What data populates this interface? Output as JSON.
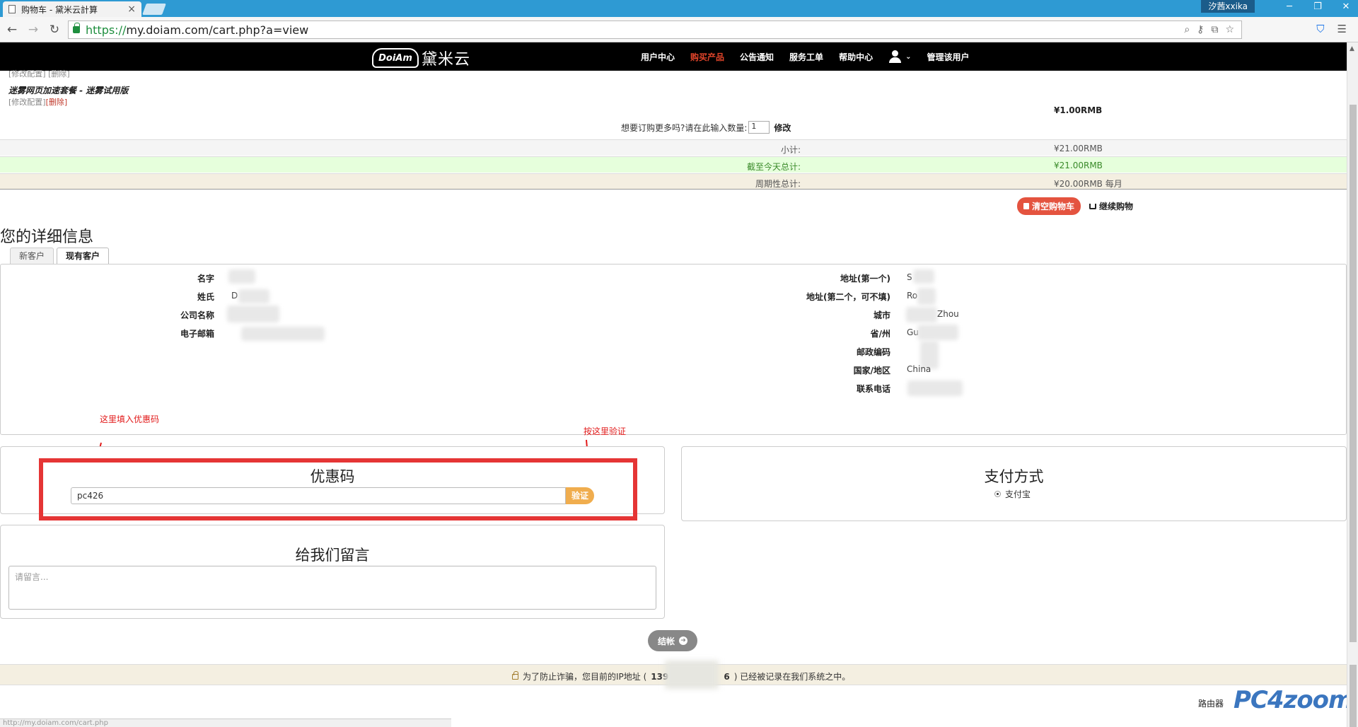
{
  "browser": {
    "tab_title": "购物车 - 黛米云計算",
    "tab_close": "×",
    "profile": "汐茜xxika",
    "url_scheme": "https://",
    "url_rest": "my.doiam.com/cart.php?a=view",
    "status_text": "http://my.doiam.com/cart.php",
    "window_min": "─",
    "window_max": "❐",
    "window_close": "✕"
  },
  "navbar": {
    "logo_mark": "DoiAm",
    "logo_text": "黛米云",
    "items": [
      "用户中心",
      "购买产品",
      "公告通知",
      "服务工单",
      "帮助中心",
      "管理该用户"
    ],
    "active_item": "购买产品"
  },
  "cart": {
    "clipped_links": "[修改配置] [删除]",
    "product_name": "迷雾网页加速套餐 - 迷雾试用版",
    "edit_link": "[修改配置]",
    "delete_link": "[删除]",
    "product_price": "¥1.00RMB",
    "qty_prompt": "想要订购更多吗?请在此输入数量:",
    "qty_value": "1",
    "qty_button": "修改",
    "subtotal_label": "小计:",
    "subtotal_value": "¥21.00RMB",
    "today_label": "截至今天总计:",
    "today_value": "¥21.00RMB",
    "recurring_label": "周期性总计:",
    "recurring_value": "¥20.00RMB 每月",
    "empty_cart": "清空购物车",
    "continue_shopping": "继续购物"
  },
  "details": {
    "title": "您的详细信息",
    "tabs": [
      "新客户",
      "现有客户"
    ],
    "active_tab": "现有客户",
    "left_fields": [
      {
        "label": "名字",
        "value": ""
      },
      {
        "label": "姓氏",
        "value": "D"
      },
      {
        "label": "公司名称",
        "value": ""
      },
      {
        "label": "电子邮箱",
        "value": ""
      }
    ],
    "right_fields": [
      {
        "label": "地址(第一个)",
        "value": "S"
      },
      {
        "label": "地址(第二个，可不填)",
        "value": "Ro"
      },
      {
        "label": "城市",
        "value": "Zhou"
      },
      {
        "label": "省/州",
        "value": "Gu"
      },
      {
        "label": "邮政编码",
        "value": ""
      },
      {
        "label": "国家/地区",
        "value": "China"
      },
      {
        "label": "联系电话",
        "value": ""
      }
    ]
  },
  "annotations": {
    "coupon_hint": "这里填入优惠码",
    "verify_hint": "按这里验证"
  },
  "coupon": {
    "title": "优惠码",
    "value": "pc426",
    "verify_button": "验证"
  },
  "payment": {
    "title": "支付方式",
    "option": "支付宝"
  },
  "notes": {
    "title": "给我们留言",
    "placeholder": "请留言..."
  },
  "checkout": {
    "button": "结帐"
  },
  "ip_notice": {
    "prefix": "为了防止诈骗，您目前的IP地址 (",
    "ip_start": "139",
    "ip_end": "6",
    "suffix": ") 已经被记录在我们系统之中。"
  },
  "watermark": {
    "text": "路由器",
    "logo": "PC4zoom"
  },
  "colors": {
    "tabbar": "#2e9ad3",
    "navbar": "#000000",
    "active_nav": "#e0442a",
    "danger_button": "#e4533f",
    "warning_button": "#f0ad4e",
    "annotation_red": "#e21b1b",
    "today_row_bg": "#e6ffdc",
    "recurring_row_bg": "#f4efe1"
  }
}
